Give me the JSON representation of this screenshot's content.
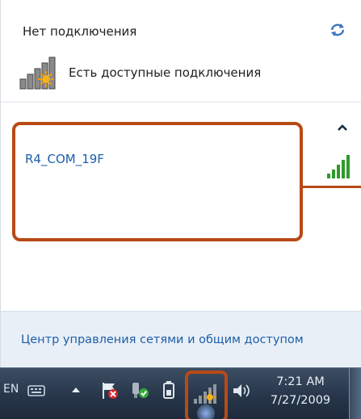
{
  "flyout": {
    "status_title": "Нет подключения",
    "status_subtitle": "Есть доступные подключения",
    "networks": [
      {
        "name": "R4_COM_19F",
        "signal_bars_filled": 5,
        "signal_bars_total": 5
      }
    ],
    "footer_link": "Центр управления сетями и общим доступом"
  },
  "taskbar": {
    "language": "EN",
    "clock": {
      "time": "7:21 AM",
      "date": "7/27/2009"
    }
  },
  "colors": {
    "link": "#1c5ea9",
    "highlight_border": "#b84a16",
    "signal_green": "#2f9a2a",
    "footer_bg": "#e9eff7",
    "taskbar_bg": "#27364a"
  },
  "icons": {
    "refresh": "refresh-icon",
    "no_connection": "wireless-bars-sunburst-icon",
    "signal": "wifi-signal-icon",
    "collapse": "chevron-up-icon"
  }
}
